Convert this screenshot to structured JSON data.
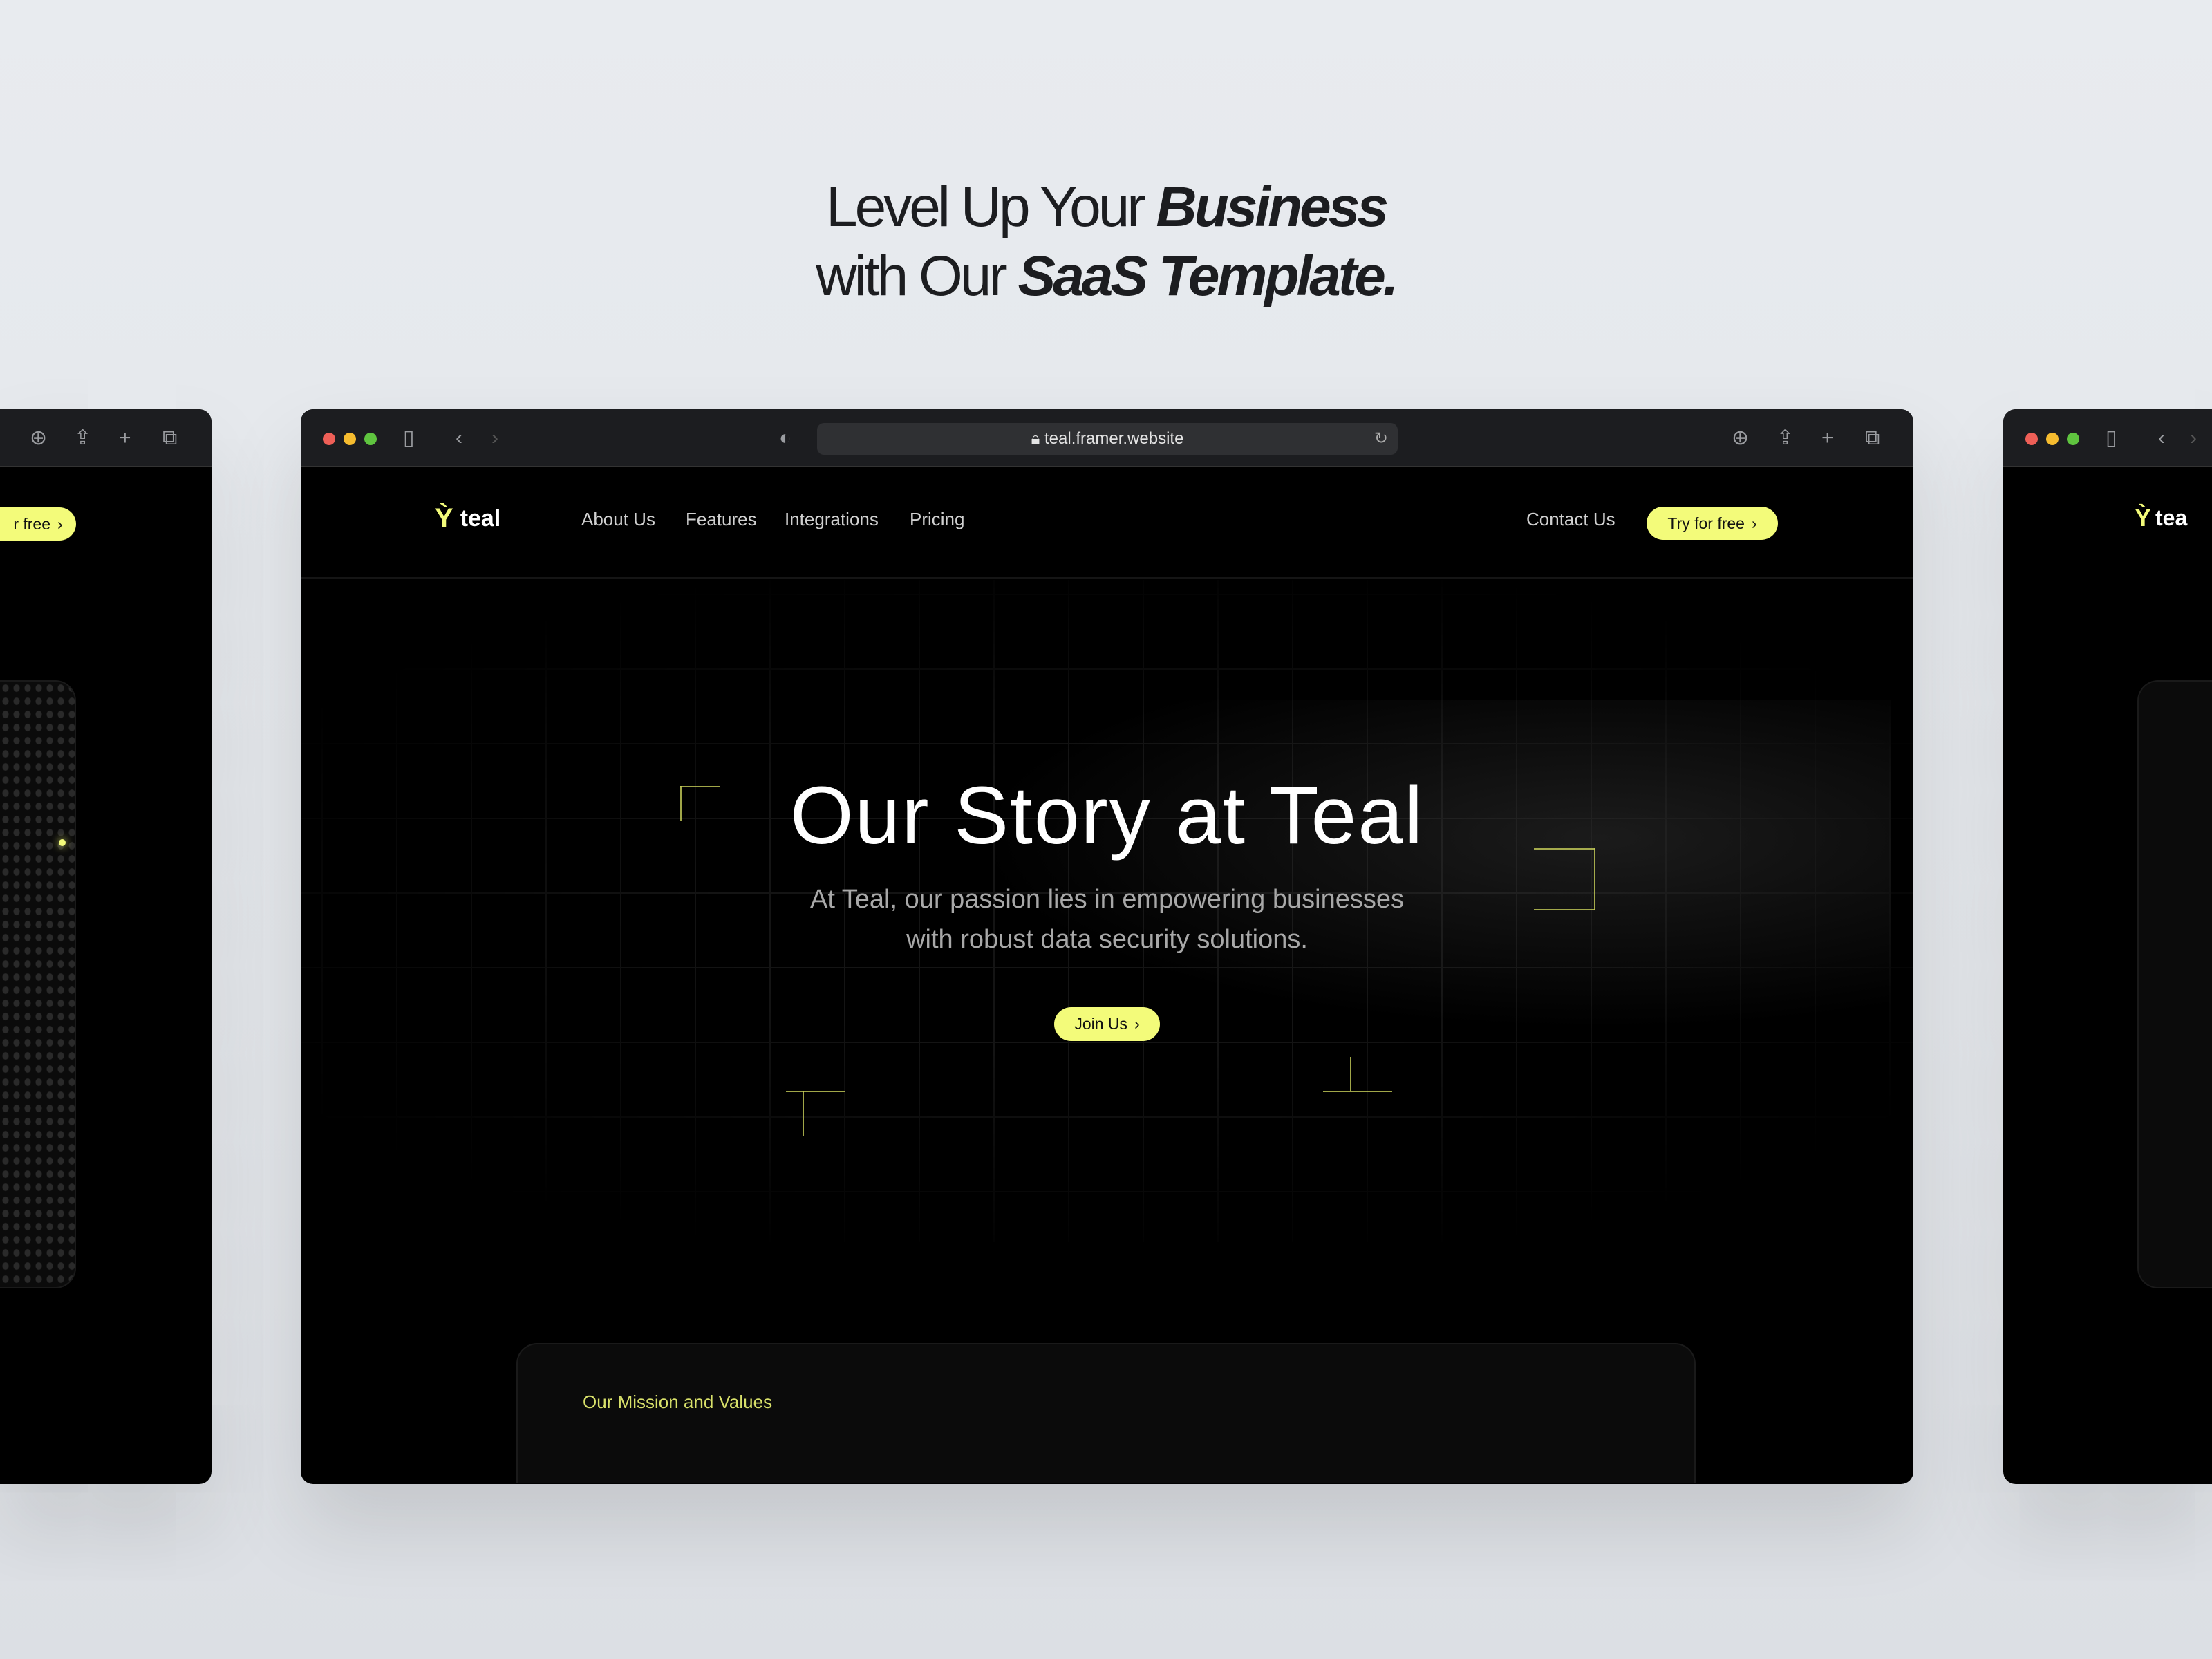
{
  "headline": {
    "line1_prefix": "Level Up Your ",
    "line1_emph": "Business",
    "line2_prefix": "with Our ",
    "line2_emph": "SaaS Template."
  },
  "browser": {
    "url": "teal.framer.website",
    "icons": [
      "sidebar-icon",
      "back-icon",
      "forward-icon",
      "shield-icon",
      "lock-icon",
      "reload-icon",
      "download-icon",
      "share-icon",
      "new-tab-icon",
      "tabs-icon"
    ]
  },
  "site": {
    "brand": "teal",
    "accent": "#f3fb7a",
    "nav": [
      "About Us",
      "Features",
      "Integrations",
      "Pricing"
    ],
    "contact": "Contact Us",
    "cta": "Try for free",
    "hero": {
      "title": "Our Story at Teal",
      "subtitle_line1": "At Teal, our passion lies in empowering businesses",
      "subtitle_line2": "with robust data security solutions.",
      "button": "Join Us"
    },
    "section_label": "Our Mission and Values"
  },
  "side_left": {
    "cta_partial": "r free"
  },
  "side_right": {
    "brand_partial": "tea"
  }
}
